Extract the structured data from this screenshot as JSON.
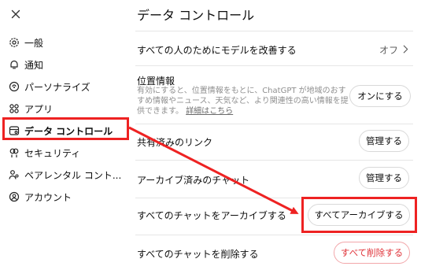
{
  "close_icon": "close-icon",
  "sidebar": {
    "items": [
      {
        "label": "一般",
        "icon": "gear-icon"
      },
      {
        "label": "通知",
        "icon": "bell-icon"
      },
      {
        "label": "パーソナライズ",
        "icon": "personalize-icon"
      },
      {
        "label": "アプリ",
        "icon": "apps-icon"
      },
      {
        "label": "データ コントロール",
        "icon": "data-controls-icon"
      },
      {
        "label": "セキュリティ",
        "icon": "security-icon"
      },
      {
        "label": "ペアレンタル コント...",
        "icon": "parental-icon"
      },
      {
        "label": "アカウント",
        "icon": "account-icon"
      }
    ],
    "active_index": 4
  },
  "main": {
    "title": "データ コントロール",
    "improve_model": {
      "label": "すべての人のためにモデルを改善する",
      "value": "オフ"
    },
    "location": {
      "label": "位置情報",
      "description": "有効にすると、位置情報をもとに、ChatGPT が地域のおすすめ情報やニュース、天気など、より関連性の高い情報を提供できます。",
      "link": "詳細はこちら",
      "button": "オンにする"
    },
    "shared_links": {
      "label": "共有済みのリンク",
      "button": "管理する"
    },
    "archived_chats": {
      "label": "アーカイブ済みのチャット",
      "button": "管理する"
    },
    "archive_all": {
      "label": "すべてのチャットをアーカイブする",
      "button": "すべてアーカイブする"
    },
    "delete_all": {
      "label": "すべてのチャットを削除する",
      "button": "すべて削除する"
    }
  },
  "colors": {
    "annotation_red": "#ee2222",
    "danger_red": "#e0343a",
    "muted_text": "#8f8f8f"
  }
}
